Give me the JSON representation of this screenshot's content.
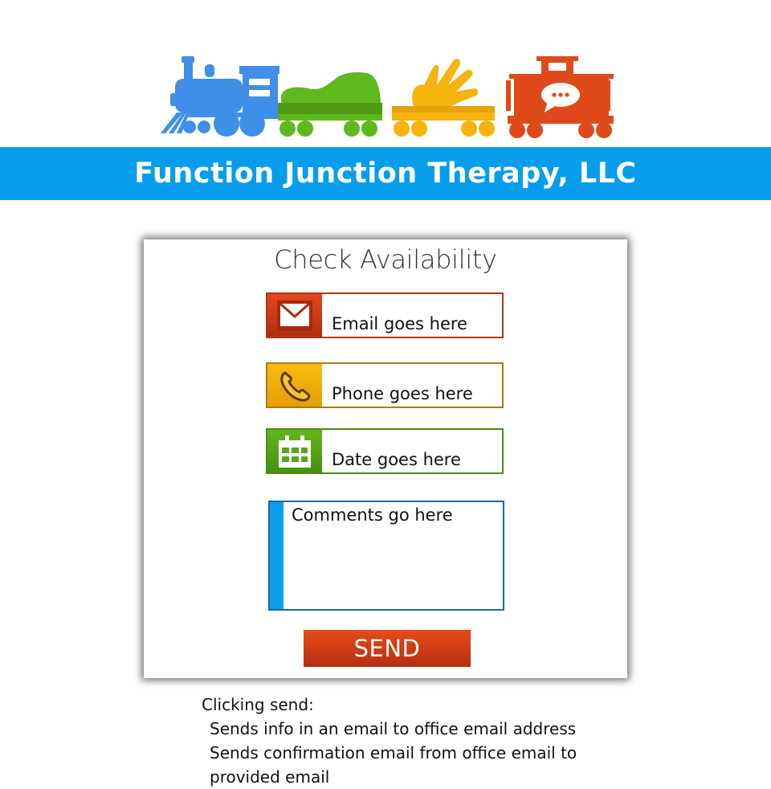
{
  "brand": {
    "name": "Function Junction Therapy, LLC",
    "banner_color": "#079ded",
    "logo_icons": [
      "locomotive-icon",
      "shoe-car-icon",
      "hand-car-icon",
      "caboose-speech-icon"
    ],
    "logo_colors": {
      "locomotive": "#3f8fe8",
      "shoe": "#5fb81e",
      "hand": "#f5b40d",
      "caboose": "#e04a1a"
    }
  },
  "form": {
    "title": "Check Availability",
    "fields": {
      "email": {
        "placeholder": "Email goes here",
        "icon": "envelope-icon",
        "color": "#d8401a"
      },
      "phone": {
        "placeholder": "Phone goes here",
        "icon": "phone-icon",
        "color": "#f2ac0a"
      },
      "date": {
        "placeholder": "Date goes here",
        "icon": "calendar-icon",
        "color": "#56a51a"
      }
    },
    "comments": {
      "placeholder": "Comments go here",
      "accent": "#0d9eee"
    },
    "send_label": "SEND"
  },
  "notes": {
    "heading": "Clicking send:",
    "lines": [
      "Sends info in an email to office email address",
      "Sends confirmation email from office email to",
      "provided email"
    ]
  }
}
